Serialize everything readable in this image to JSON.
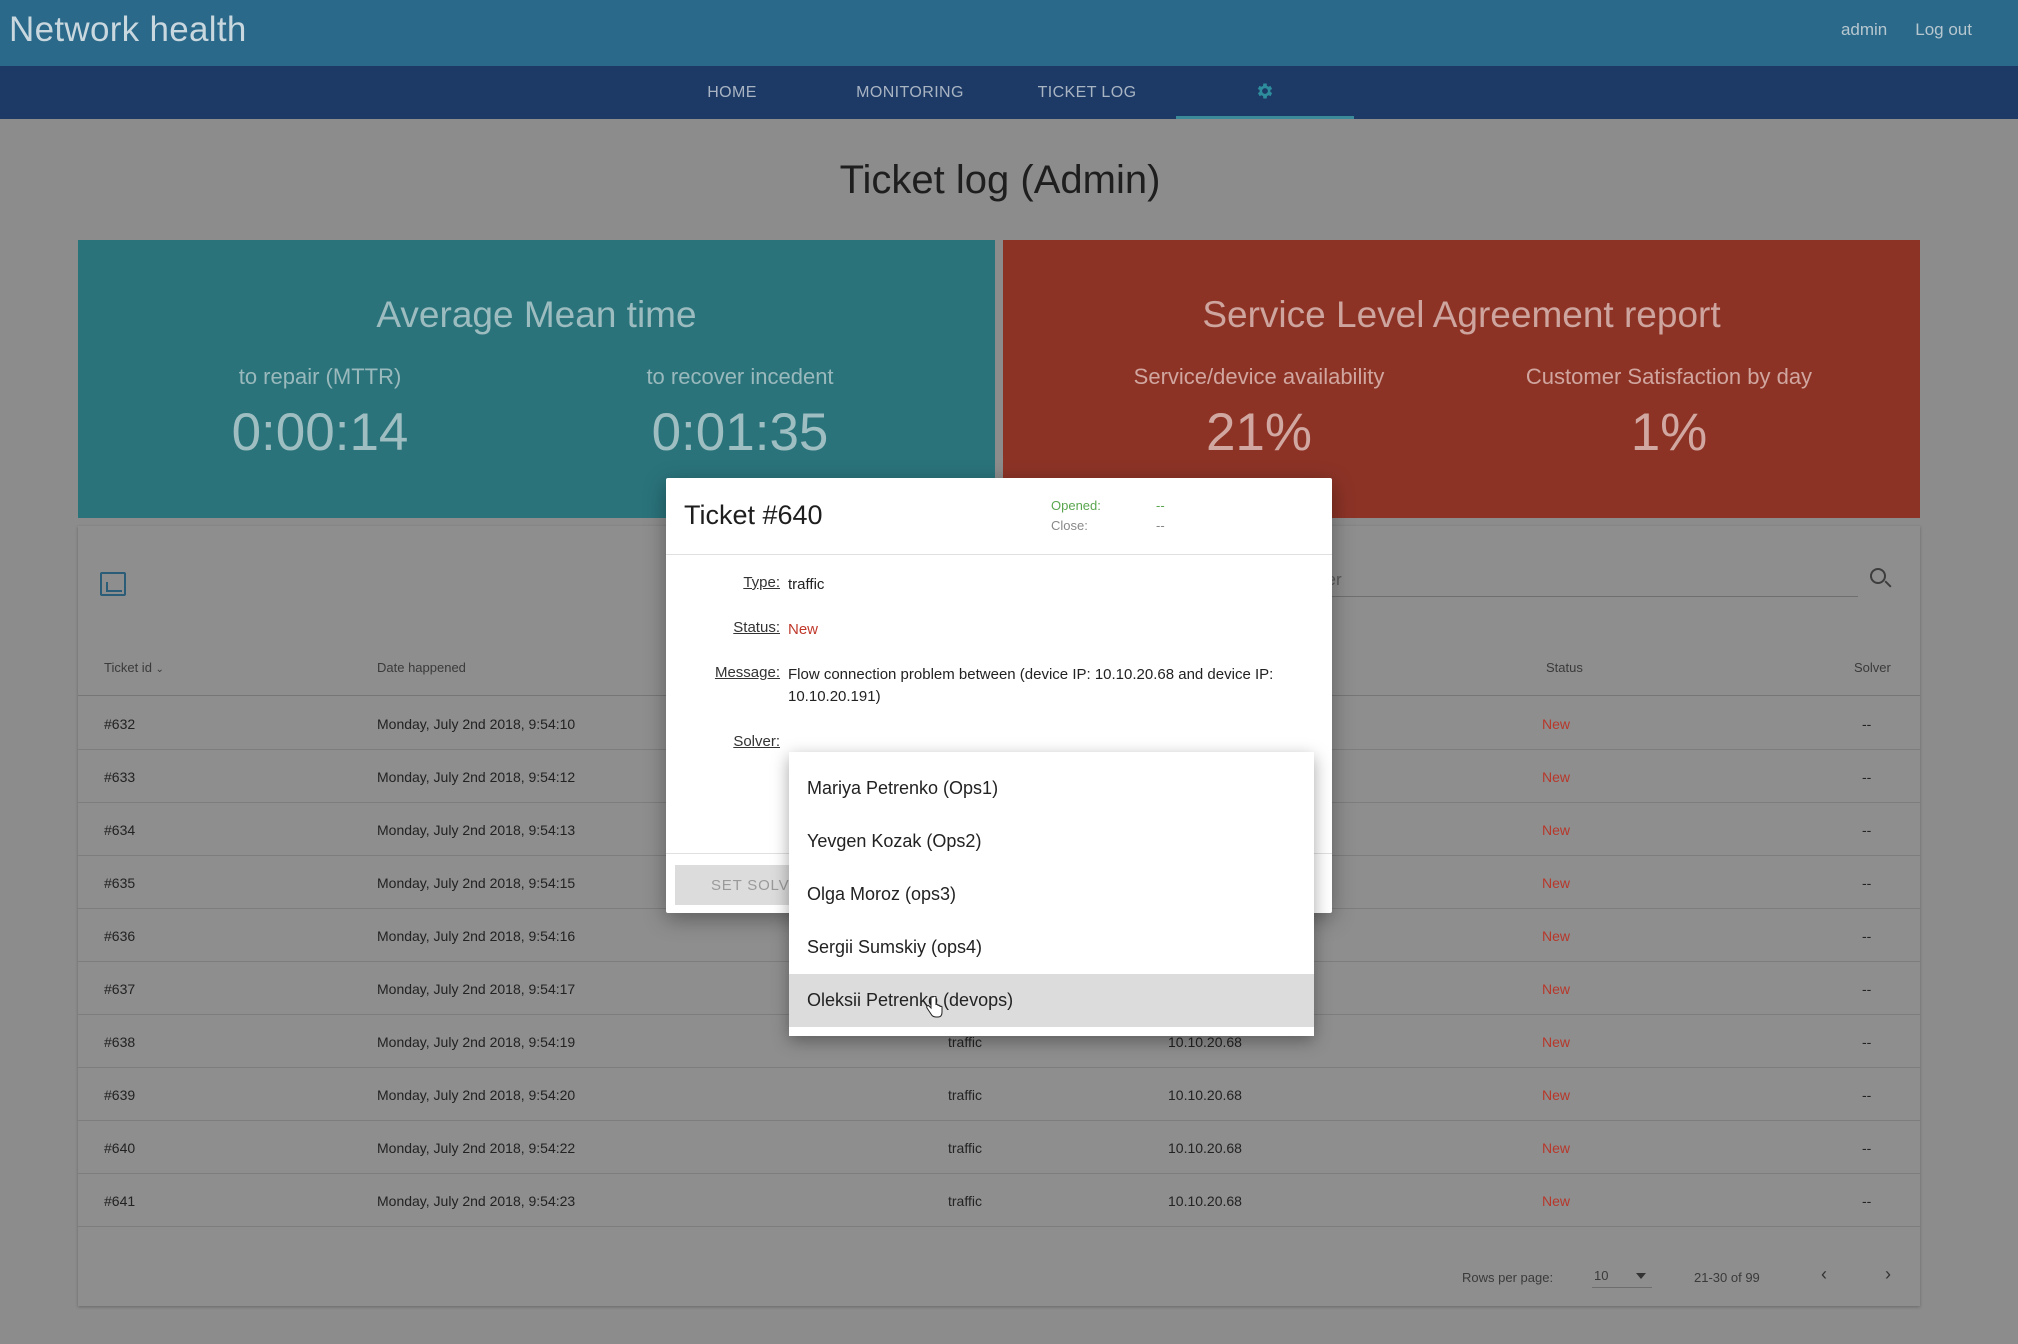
{
  "header": {
    "app_title": "Network health",
    "user": "admin",
    "logout": "Log out"
  },
  "nav": {
    "tabs": [
      "HOME",
      "MONITORING",
      "TICKET LOG"
    ],
    "settings_icon": "gear-icon"
  },
  "page": {
    "title": "Ticket log (Admin)"
  },
  "cards": {
    "mean_time": {
      "title": "Average Mean time",
      "metrics": [
        {
          "label": "to repair (MTTR)",
          "value": "0:00:14"
        },
        {
          "label": "to recover incedent",
          "value": "0:01:35"
        }
      ]
    },
    "sla": {
      "title": "Service Level Agreement report",
      "metrics": [
        {
          "label": "Service/device availability",
          "value": "21%"
        },
        {
          "label": "Customer Satisfaction by day",
          "value": "1%"
        }
      ]
    }
  },
  "table": {
    "filter_text": "lter",
    "columns": {
      "ticket_id": "Ticket id",
      "date": "Date happened",
      "status": "Status",
      "solver": "Solver"
    },
    "rows": [
      {
        "id": "#632",
        "date": "Monday, July 2nd 2018, 9:54:10",
        "type": "",
        "ip": "",
        "status": "New",
        "solver": "--"
      },
      {
        "id": "#633",
        "date": "Monday, July 2nd 2018, 9:54:12",
        "type": "",
        "ip": "",
        "status": "New",
        "solver": "--"
      },
      {
        "id": "#634",
        "date": "Monday, July 2nd 2018, 9:54:13",
        "type": "",
        "ip": "",
        "status": "New",
        "solver": "--"
      },
      {
        "id": "#635",
        "date": "Monday, July 2nd 2018, 9:54:15",
        "type": "",
        "ip": "",
        "status": "New",
        "solver": "--"
      },
      {
        "id": "#636",
        "date": "Monday, July 2nd 2018, 9:54:16",
        "type": "",
        "ip": "",
        "status": "New",
        "solver": "--"
      },
      {
        "id": "#637",
        "date": "Monday, July 2nd 2018, 9:54:17",
        "type": "",
        "ip": "",
        "status": "New",
        "solver": "--"
      },
      {
        "id": "#638",
        "date": "Monday, July 2nd 2018, 9:54:19",
        "type": "traffic",
        "ip": "10.10.20.68",
        "status": "New",
        "solver": "--"
      },
      {
        "id": "#639",
        "date": "Monday, July 2nd 2018, 9:54:20",
        "type": "traffic",
        "ip": "10.10.20.68",
        "status": "New",
        "solver": "--"
      },
      {
        "id": "#640",
        "date": "Monday, July 2nd 2018, 9:54:22",
        "type": "traffic",
        "ip": "10.10.20.68",
        "status": "New",
        "solver": "--"
      },
      {
        "id": "#641",
        "date": "Monday, July 2nd 2018, 9:54:23",
        "type": "traffic",
        "ip": "10.10.20.68",
        "status": "New",
        "solver": "--"
      }
    ],
    "footer": {
      "rows_per_page_label": "Rows per page:",
      "rows_per_page": "10",
      "range": "21-30 of 99"
    }
  },
  "modal": {
    "title": "Ticket #640",
    "opened_label": "Opened:",
    "opened_value": "--",
    "close_label": "Close:",
    "close_value": "--",
    "type_label": "Type:",
    "type_value": "traffic",
    "status_label": "Status:",
    "status_value": "New",
    "message_label": "Message:",
    "message_value": "Flow connection problem between (device IP: 10.10.20.68 and device IP: 10.10.20.191)",
    "solver_label": "Solver:",
    "set_solver_button": "SET SOLVER"
  },
  "solver_options": [
    "Mariya Petrenko (Ops1)",
    "Yevgen Kozak (Ops2)",
    "Olga Moroz (ops3)",
    "Sergii Sumskiy (ops4)",
    "Oleksii Petrenko (devops)"
  ],
  "colors": {
    "header": "#2a6989",
    "nav": "#1d3a66",
    "teal_card": "#2a737b",
    "red_card": "#8c3326",
    "status_new": "#b8372a",
    "opened_green": "#4caf50"
  }
}
